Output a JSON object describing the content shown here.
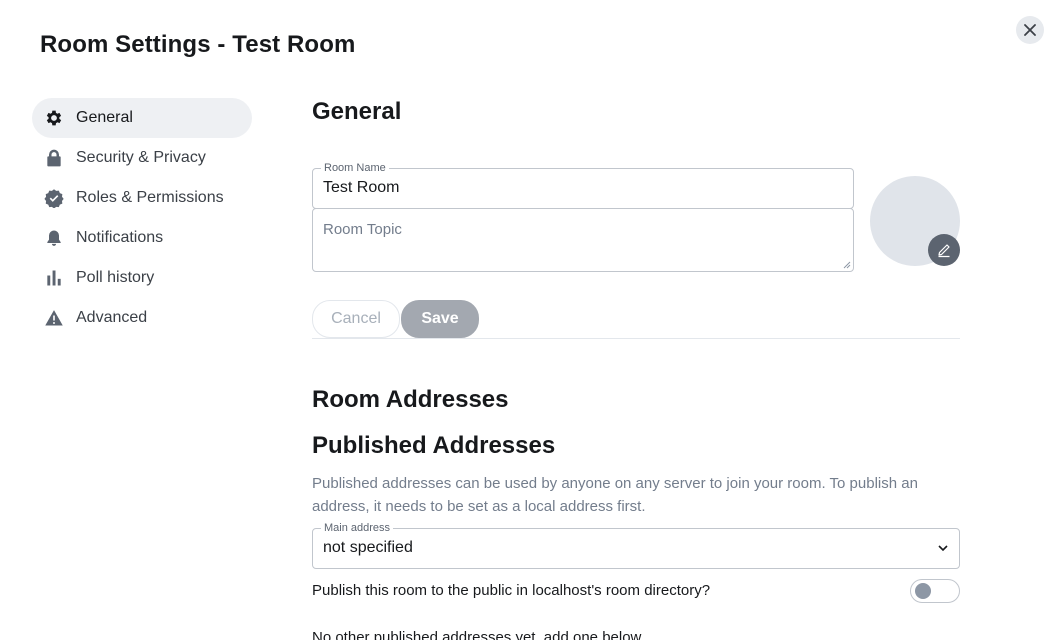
{
  "dialog": {
    "title": "Room Settings - Test Room",
    "close_icon": "close-icon"
  },
  "sidebar": {
    "items": [
      {
        "label": "General",
        "icon": "gear-icon",
        "active": true
      },
      {
        "label": "Security & Privacy",
        "icon": "lock-icon",
        "active": false
      },
      {
        "label": "Roles & Permissions",
        "icon": "verified-badge-icon",
        "active": false
      },
      {
        "label": "Notifications",
        "icon": "bell-icon",
        "active": false
      },
      {
        "label": "Poll history",
        "icon": "bar-chart-icon",
        "active": false
      },
      {
        "label": "Advanced",
        "icon": "warning-icon",
        "active": false
      }
    ]
  },
  "general": {
    "title": "General",
    "room_name": {
      "label": "Room Name",
      "value": "Test Room"
    },
    "room_topic": {
      "placeholder": "Room Topic",
      "value": ""
    },
    "avatar_edit_icon": "pencil-icon",
    "cancel_label": "Cancel",
    "save_label": "Save"
  },
  "addresses": {
    "title": "Room Addresses",
    "published_title": "Published Addresses",
    "description": "Published addresses can be used by anyone on any server to join your room. To publish an address, it needs to be set as a local address first.",
    "main_address": {
      "label": "Main address",
      "value": "not specified"
    },
    "publish_toggle_label": "Publish this room to the public in localhost's room directory?",
    "publish_toggle_on": false,
    "no_published_note": "No other published addresses yet, add one below"
  },
  "colors": {
    "accent": "#0dbd8b",
    "active_bg": "#eef0f3",
    "muted_text": "#737d8c",
    "disabled_button": "#a3a8b0"
  }
}
